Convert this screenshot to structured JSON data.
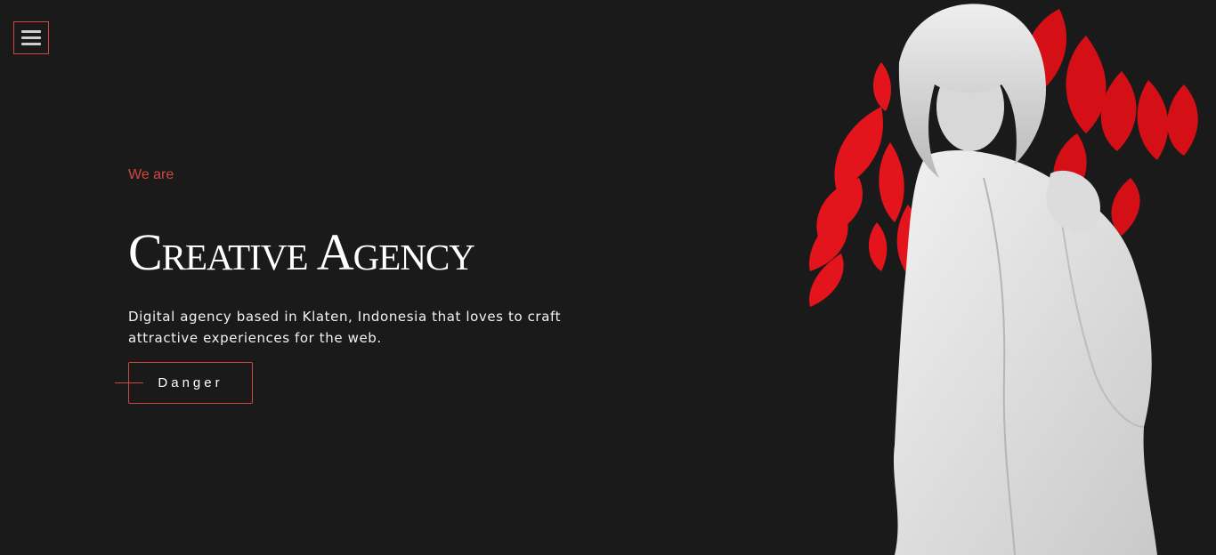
{
  "nav": {
    "menu_icon": "hamburger-icon"
  },
  "hero": {
    "eyebrow": "We are",
    "title": "Creative Agency",
    "description": "Digital agency based in Klaten, Indonesia that loves to craft attractive experiences for the web.",
    "cta_label": "Danger",
    "image_alt": "Woman in white coat with red leaves"
  },
  "colors": {
    "background": "#1a1a1b",
    "accent": "#d0473f",
    "text": "#ffffff",
    "leaf_red": "#e3141c"
  }
}
